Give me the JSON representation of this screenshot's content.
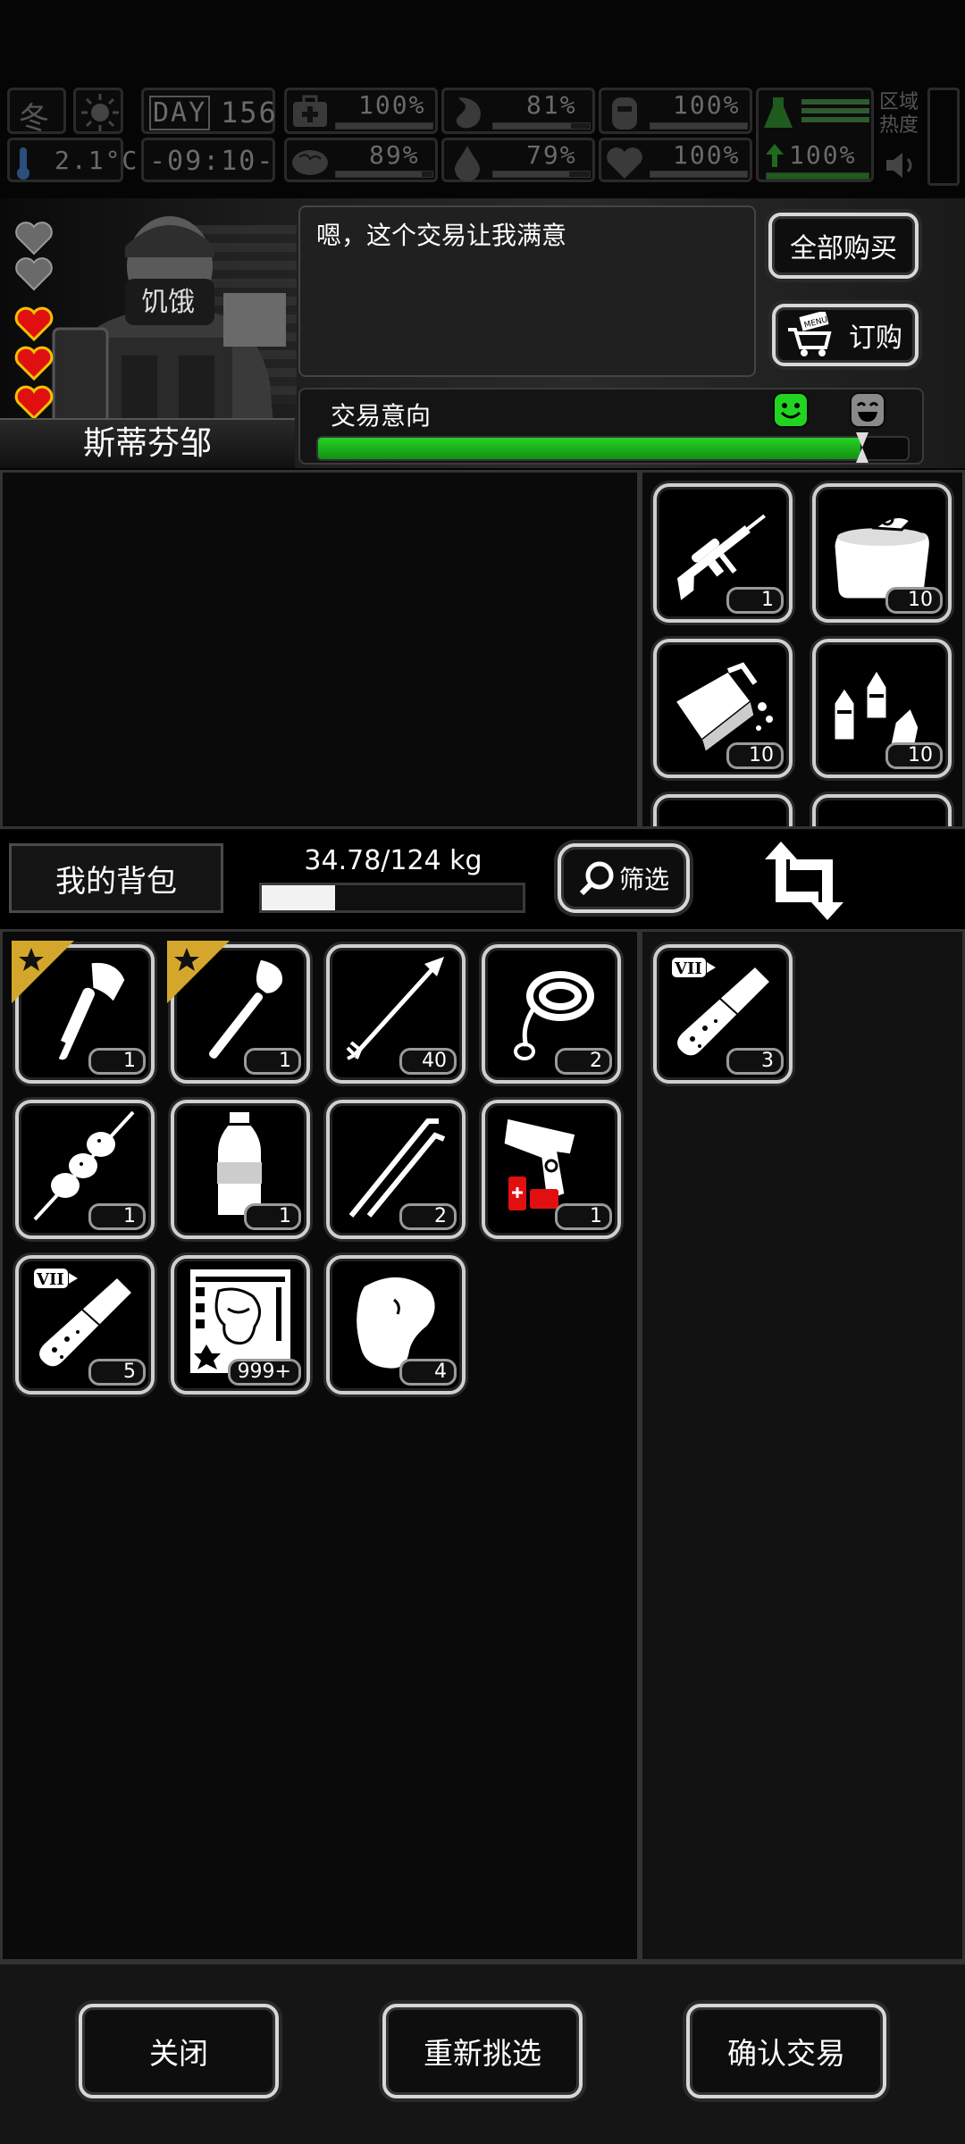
{
  "status_bar": {
    "season": "冬",
    "day_label": "DAY",
    "day": "156",
    "temperature": "2.1°C",
    "time": "-09:10-",
    "stats": {
      "health": "100%",
      "hunger": "81%",
      "armor": "100%",
      "brain": "89%",
      "thirst": "79%",
      "heart": "100%",
      "energy": "100%"
    },
    "region_heat_label": "区域热度"
  },
  "trader": {
    "name": "斯蒂芬邹",
    "mask_text": "饥饿",
    "hearts_total": 5,
    "hearts_filled": 3,
    "dialog": "嗯，这个交易让我满意",
    "intent_label": "交易意向",
    "intent_value": 0.92
  },
  "actions": {
    "buy_all": "全部购买",
    "order": "订购",
    "order_sign": "MENU"
  },
  "trader_items": [
    {
      "icon": "sniper-rifle-icon",
      "qty": "1"
    },
    {
      "icon": "canned-food-icon",
      "qty": "10"
    },
    {
      "icon": "chocolate-bar-icon",
      "qty": "10"
    },
    {
      "icon": "seasoning-bottles-icon",
      "qty": "10"
    }
  ],
  "backpack": {
    "title": "我的背包",
    "weight": "34.78/124 kg",
    "weight_fraction": 0.28,
    "filter": "筛选",
    "items": [
      {
        "icon": "axe-icon",
        "qty": "1",
        "starred": true
      },
      {
        "icon": "shovel-icon",
        "qty": "1",
        "starred": true
      },
      {
        "icon": "arrow-icon",
        "qty": "40",
        "starred": false
      },
      {
        "icon": "rope-icon",
        "qty": "2",
        "starred": false
      },
      {
        "icon": "meat-skewer-icon",
        "qty": "1",
        "starred": false
      },
      {
        "icon": "water-bottle-icon",
        "qty": "1",
        "starred": false
      },
      {
        "icon": "lockpick-icon",
        "qty": "2",
        "starred": false
      },
      {
        "icon": "flare-gun-icon",
        "qty": "1",
        "starred": false
      },
      {
        "icon": "test-tube-icon",
        "qty": "5",
        "starred": false,
        "tag": "VII"
      },
      {
        "icon": "zombie-poster-icon",
        "qty": "999+",
        "starred": false
      },
      {
        "icon": "raw-meat-icon",
        "qty": "4",
        "starred": false
      }
    ]
  },
  "offer_items": [
    {
      "icon": "test-tube-icon",
      "qty": "3",
      "tag": "VII"
    }
  ],
  "footer": {
    "close": "关闭",
    "reselect": "重新挑选",
    "confirm": "确认交易"
  },
  "colors": {
    "accent_green": "#1dba1d",
    "smiley_green": "#22d422",
    "heart_red": "#e01010",
    "star_gold": "#d4a72c"
  }
}
